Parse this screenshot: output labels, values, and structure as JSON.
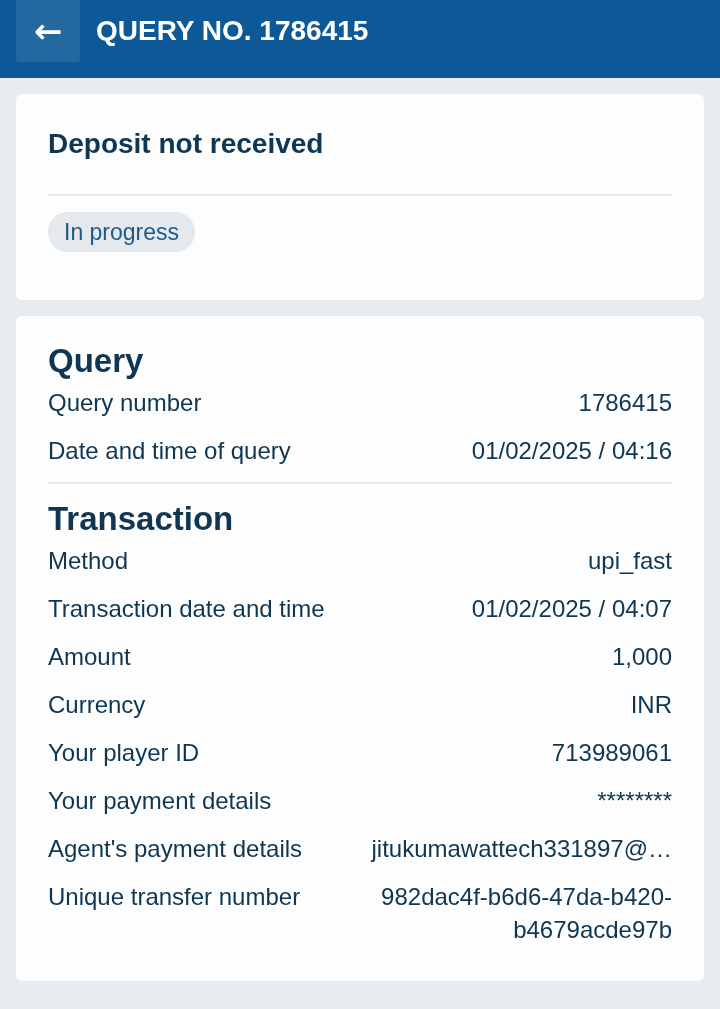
{
  "header": {
    "back_icon": "←",
    "title": "QUERY NO. 1786415"
  },
  "summary": {
    "title": "Deposit not received",
    "status": "In progress"
  },
  "sections": [
    {
      "title": "Query",
      "rows": [
        {
          "label": "Query number",
          "value": "1786415"
        },
        {
          "label": "Date and time of query",
          "value": "01/02/2025 / 04:16"
        }
      ]
    },
    {
      "title": "Transaction",
      "rows": [
        {
          "label": "Method",
          "value": "upi_fast"
        },
        {
          "label": "Transaction date and time",
          "value": "01/02/2025 / 04:07"
        },
        {
          "label": "Amount",
          "value": "1,000"
        },
        {
          "label": "Currency",
          "value": "INR"
        },
        {
          "label": "Your player ID",
          "value": "713989061"
        },
        {
          "label": "Your payment details",
          "value": "********"
        },
        {
          "label": "Agent's payment details",
          "value": "jitukumawattech331897@…"
        },
        {
          "label": "Unique transfer number",
          "value": "982dac4f-b6d6-47da-b420-b4679acde97b"
        }
      ]
    }
  ]
}
